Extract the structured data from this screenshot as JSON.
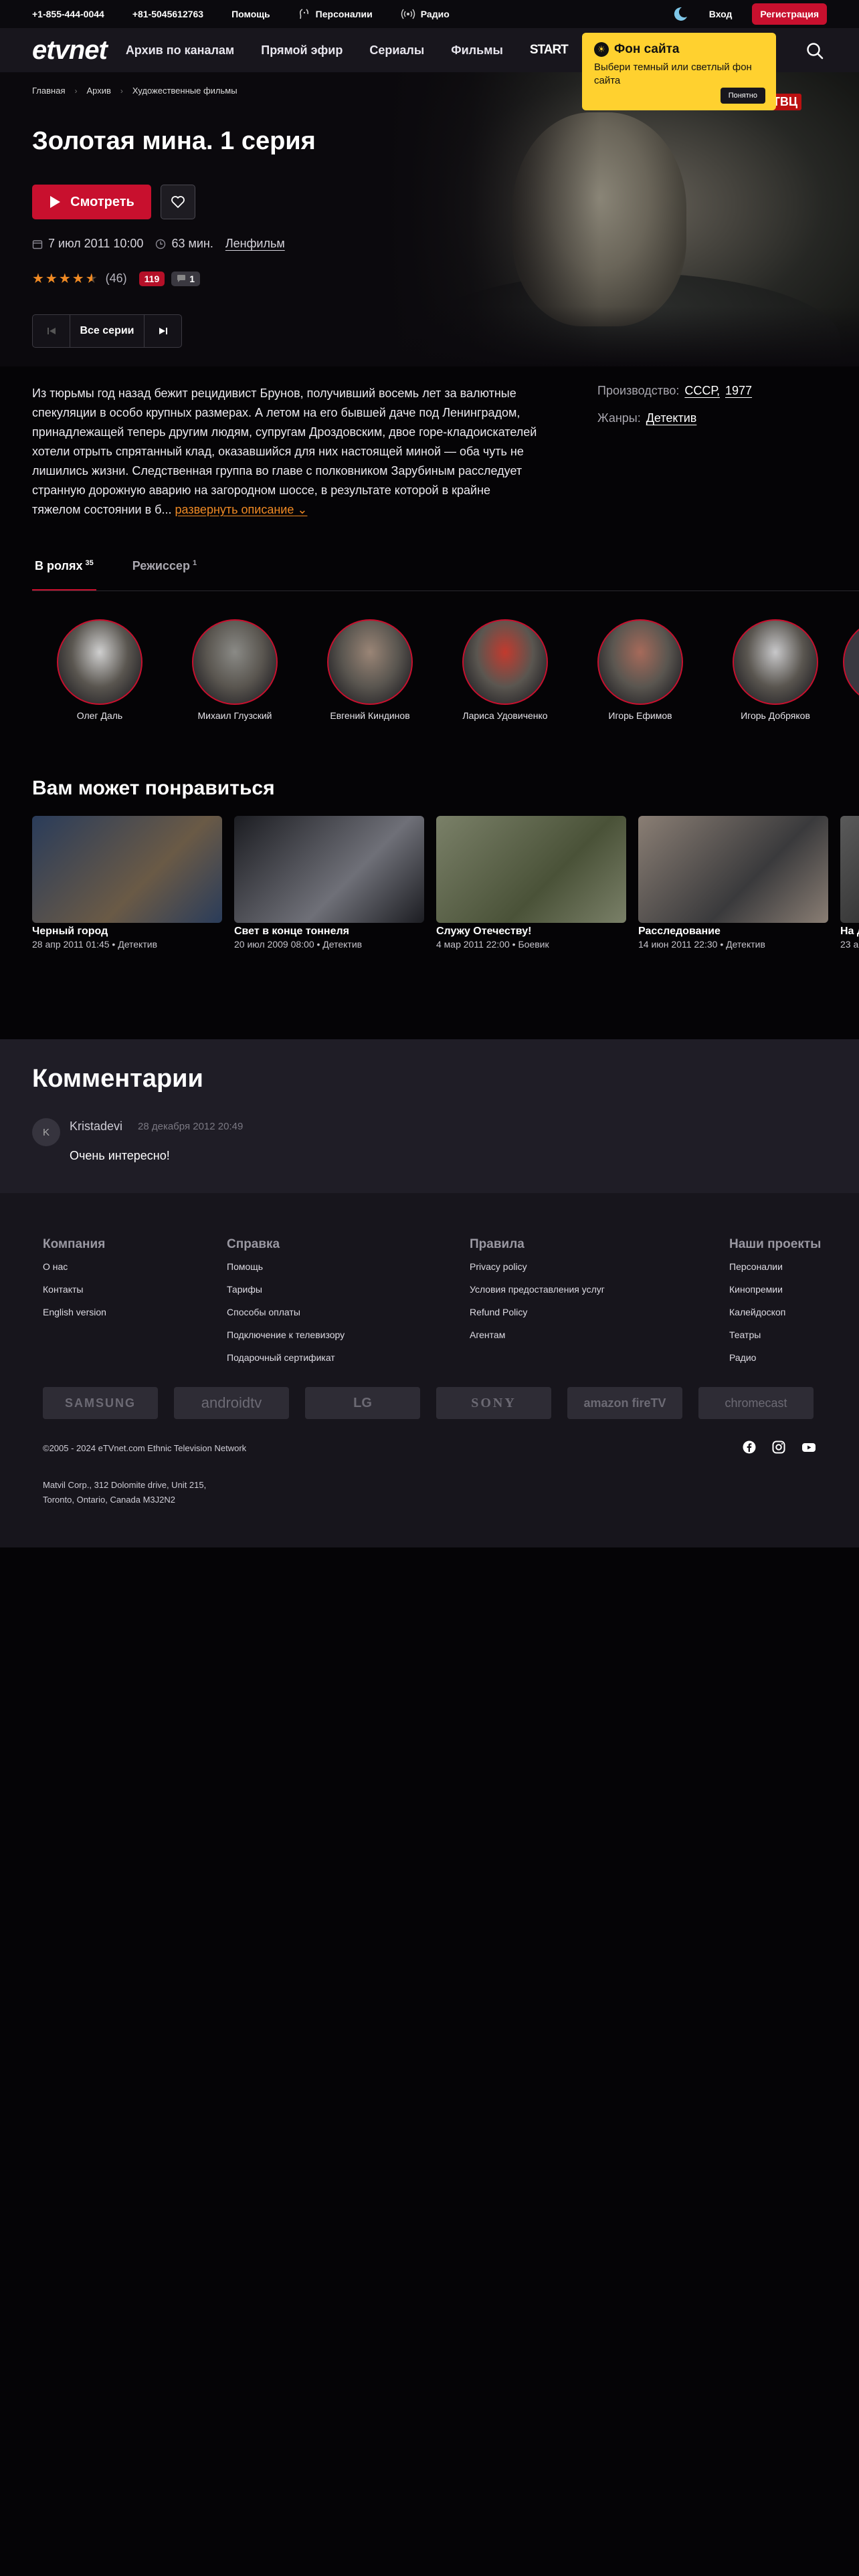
{
  "topbar": {
    "phone1": "+1-855-444-0044",
    "phone2": "+81-5045612763",
    "help": "Помощь",
    "personalii": "Персоналии",
    "radio": "Радио",
    "login": "Вход",
    "register": "Регистрация"
  },
  "nav": {
    "logo": "etvnet",
    "items": [
      "Архив по каналам",
      "Прямой эфир",
      "Сериалы",
      "Фильмы"
    ],
    "start": "START"
  },
  "tooltip": {
    "title": "Фон сайта",
    "text": "Выбери темный или светлый фон сайта",
    "button": "Понятно"
  },
  "breadcrumb": [
    "Главная",
    "Архив",
    "Художественные фильмы"
  ],
  "movie": {
    "title": "Золотая мина. 1 серия",
    "watch": "Смотреть",
    "date": "7 июл 2011 10:00",
    "duration": "63 мин.",
    "studio": "Ленфильм",
    "rating_stars": 4.5,
    "rating_count": "(46)",
    "badge_red": "119",
    "badge_comments": "1",
    "all_series": "Все серии",
    "channel_logo": "ТВЦ"
  },
  "description": {
    "text": "Из тюрьмы год назад бежит рецидивист Брунов, получивший восемь лет за валютные спекуляции в особо крупных размерах. А летом на его бывшей даче под Ленинградом, принадлежащей теперь другим людям, супругам Дроздовским, двое горе-кладоискателей хотели отрыть спрятанный клад, оказавшийся для них настоящей миной — оба чуть не лишились жизни. Следственная группа во главе с полковником Зарубиным расследует странную дорожную аварию на загородном шоссе, в результате которой в крайне тяжелом состоянии в б...",
    "more": "развернуть описание"
  },
  "info": {
    "production_label": "Производство:",
    "country": "СССР,",
    "year": "1977",
    "genres_label": "Жанры:",
    "genre": "Детектив"
  },
  "tabs": [
    {
      "label": "В ролях",
      "count": "35"
    },
    {
      "label": "Режиссер",
      "count": "1"
    }
  ],
  "cast": [
    {
      "name": "Олег Даль",
      "tone": "#cfcfcf"
    },
    {
      "name": "Михаил Глузский",
      "tone": "#8a8a86"
    },
    {
      "name": "Евгений Киндинов",
      "tone": "#9a8576"
    },
    {
      "name": "Лариса Удовиченко",
      "tone": "#c23a2e"
    },
    {
      "name": "Игорь Ефимов",
      "tone": "#a66a5a"
    },
    {
      "name": "Игорь Добряков",
      "tone": "#c8c8ca"
    }
  ],
  "recommend": {
    "title": "Вам может понравиться",
    "items": [
      {
        "title": "Черный город",
        "meta": "28 апр 2011 01:45 • Детектив",
        "c1": "#2a3c5a",
        "c2": "#6a5a46"
      },
      {
        "title": "Свет в конце тоннеля",
        "meta": "20 июл 2009 08:00 • Детектив",
        "c1": "#1c1d22",
        "c2": "#6f7078"
      },
      {
        "title": "Служу Отечеству!",
        "meta": "4 мар 2011 22:00 • Боевик",
        "c1": "#7a8068",
        "c2": "#4a5238"
      },
      {
        "title": "Расследование",
        "meta": "14 июн 2011 22:30 • Детектив",
        "c1": "#8a7e74",
        "c2": "#3a3a3c"
      },
      {
        "title": "На Д",
        "meta": "23 а",
        "c1": "#5a5a5a",
        "c2": "#2a2a2a"
      }
    ]
  },
  "comments": {
    "title": "Комментарии",
    "avatar_letter": "K",
    "user": "Kristadevi",
    "date": "28 декабря 2012 20:49",
    "text": "Очень интересно!"
  },
  "footer": {
    "company": {
      "title": "Компания",
      "links": [
        "О нас",
        "Контакты",
        "English version"
      ]
    },
    "help": {
      "title": "Справка",
      "links": [
        "Помощь",
        "Тарифы",
        "Способы оплаты",
        "Подключение к телевизору",
        "Подарочный сертификат"
      ]
    },
    "rules": {
      "title": "Правила",
      "links": [
        "Privacy policy",
        "Условия предоставления услуг",
        "Refund Policy",
        "Агентам"
      ]
    },
    "projects": {
      "title": "Наши проекты",
      "links": [
        "Персоналии",
        "Кинопремии",
        "Калейдоскоп",
        "Театры",
        "Радио"
      ]
    },
    "brands": [
      "SAMSUNG",
      "androidtv",
      "LG",
      "SONY",
      "amazon fireTV",
      "chromecast"
    ],
    "copyright": "©2005 - 2024 eTVnet.com Ethnic Television Network",
    "address1": "Matvil Corp., 312 Dolomite drive, Unit 215,",
    "address2": "Toronto, Ontario, Canada M3J2N2"
  },
  "colors": {
    "accent": "#c8102e",
    "orange": "#f08a24",
    "tooltip": "#ffd12f",
    "bg": "#0b090d"
  }
}
